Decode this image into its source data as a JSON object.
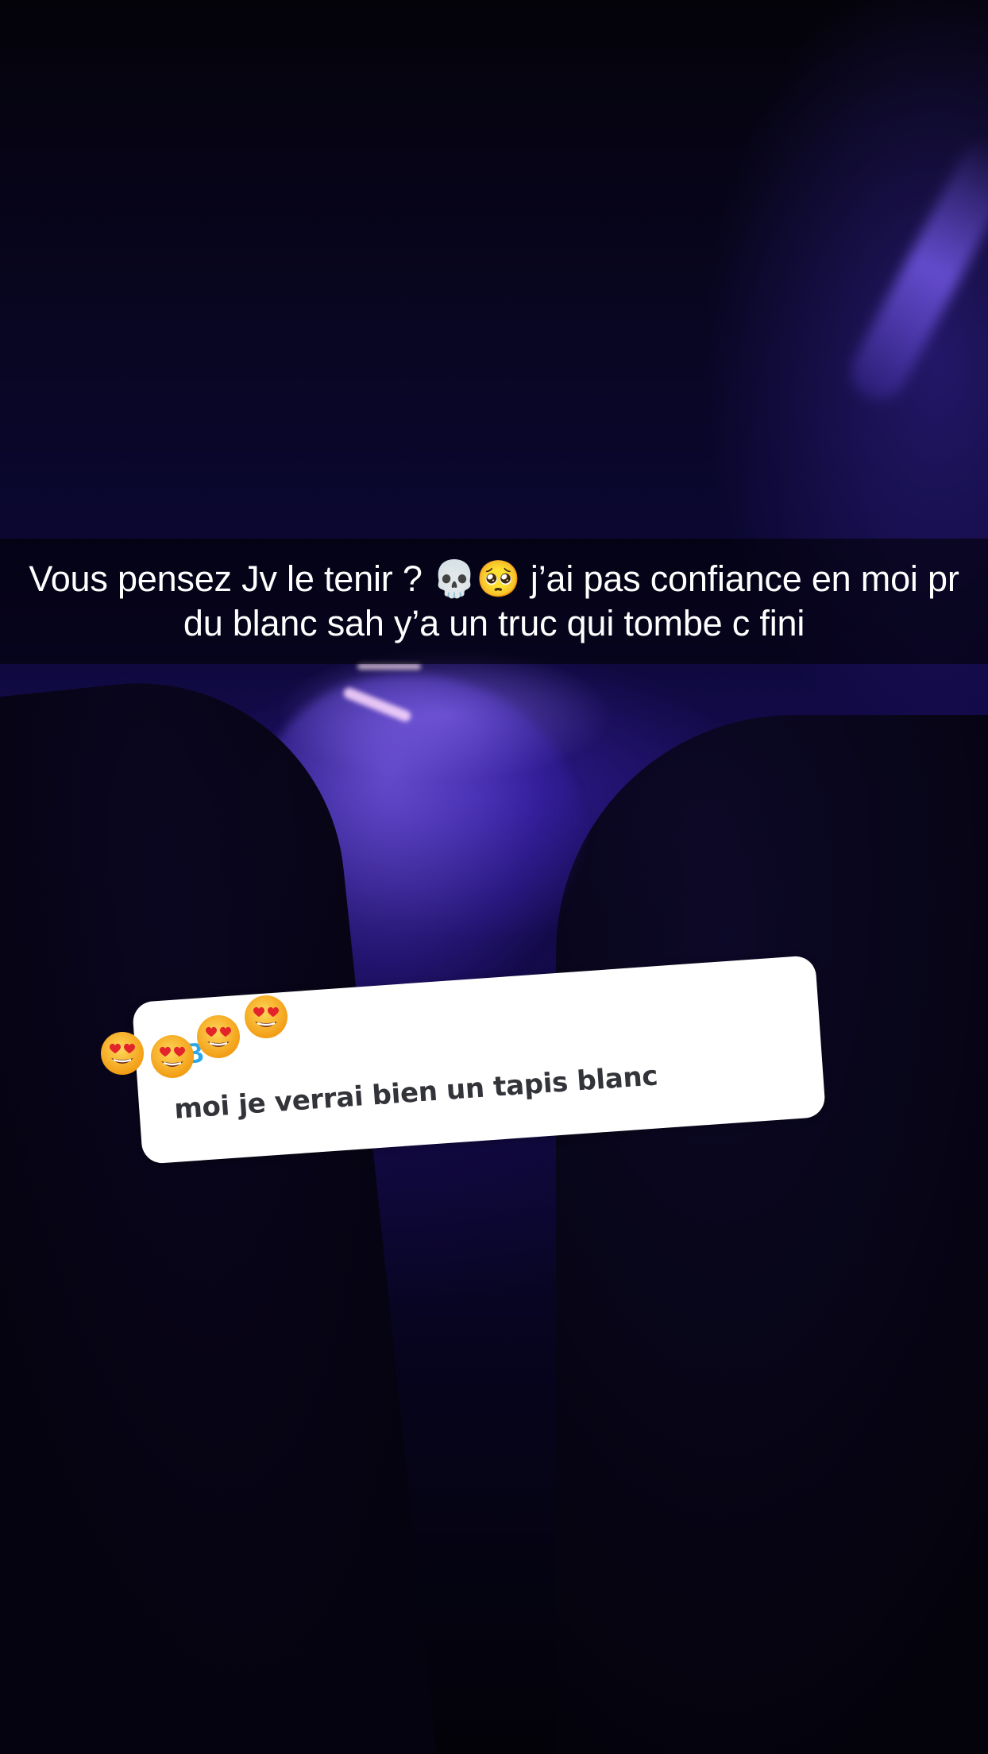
{
  "snap": {
    "caption": "Vous pensez Jv le tenir ? 💀🥺 j’ai pas confiance en moi pr du blanc sah y’a un truc qui tombe c fini",
    "reply_sticker": {
      "avatar_letter": "B",
      "text": "moi je verrai bien un tapis blanc",
      "reactions": [
        "heart-eyes-emoji",
        "heart-eyes-emoji",
        "heart-eyes-emoji",
        "heart-eyes-emoji"
      ]
    }
  },
  "colors": {
    "caption_bar": "#000000",
    "caption_text": "#ffffff",
    "sticker_bg": "#ffffff",
    "sticker_text": "#33343a",
    "avatar_letter": "#2aa7e8",
    "ambient_light": "#5a3ce0"
  }
}
